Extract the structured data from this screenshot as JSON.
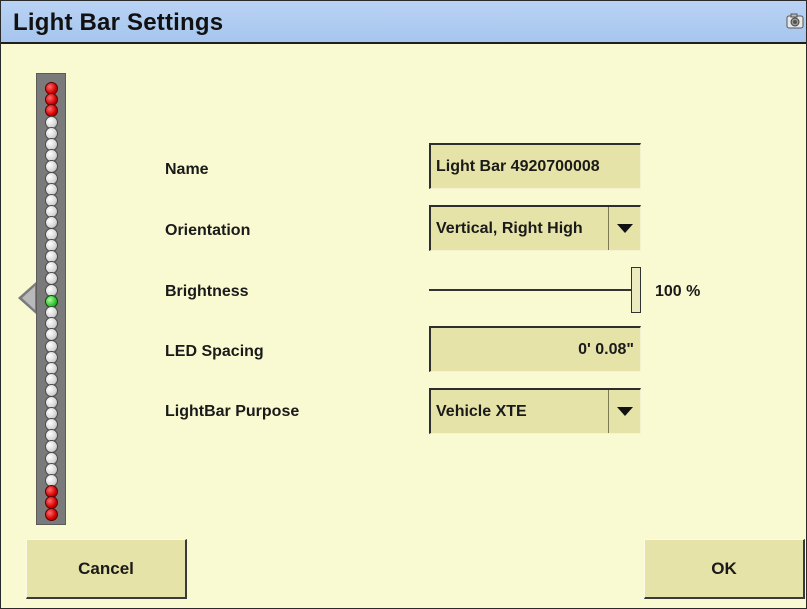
{
  "window": {
    "title": "Light Bar Settings",
    "camera_icon": "camera-icon"
  },
  "lightbar": {
    "leds": [
      "red",
      "red",
      "red",
      "gray",
      "gray",
      "gray",
      "gray",
      "gray",
      "gray",
      "gray",
      "gray",
      "gray",
      "gray",
      "gray",
      "gray",
      "gray",
      "gray",
      "gray",
      "gray",
      "green",
      "gray",
      "gray",
      "gray",
      "gray",
      "gray",
      "gray",
      "gray",
      "gray",
      "gray",
      "gray",
      "gray",
      "gray",
      "gray",
      "gray",
      "gray",
      "gray",
      "red",
      "red",
      "red"
    ],
    "colors": {
      "red": "#d30000",
      "gray": "#d6d6d6",
      "green": "#2fc02f",
      "housing": "#7a7a7a"
    }
  },
  "form": {
    "name": {
      "label": "Name",
      "value": "Light Bar 4920700008"
    },
    "orientation": {
      "label": "Orientation",
      "value": "Vertical, Right High"
    },
    "brightness": {
      "label": "Brightness",
      "value_text": "100 %",
      "level": 1.0
    },
    "led_spacing": {
      "label": "LED Spacing",
      "value": "0' 0.08\""
    },
    "purpose": {
      "label": "LightBar Purpose",
      "value": "Vehicle XTE"
    }
  },
  "buttons": {
    "cancel": "Cancel",
    "ok": "OK"
  },
  "theme": {
    "background": "#fafad2",
    "titlebar": "#b0ccf1",
    "field": "#e6e3a8"
  }
}
